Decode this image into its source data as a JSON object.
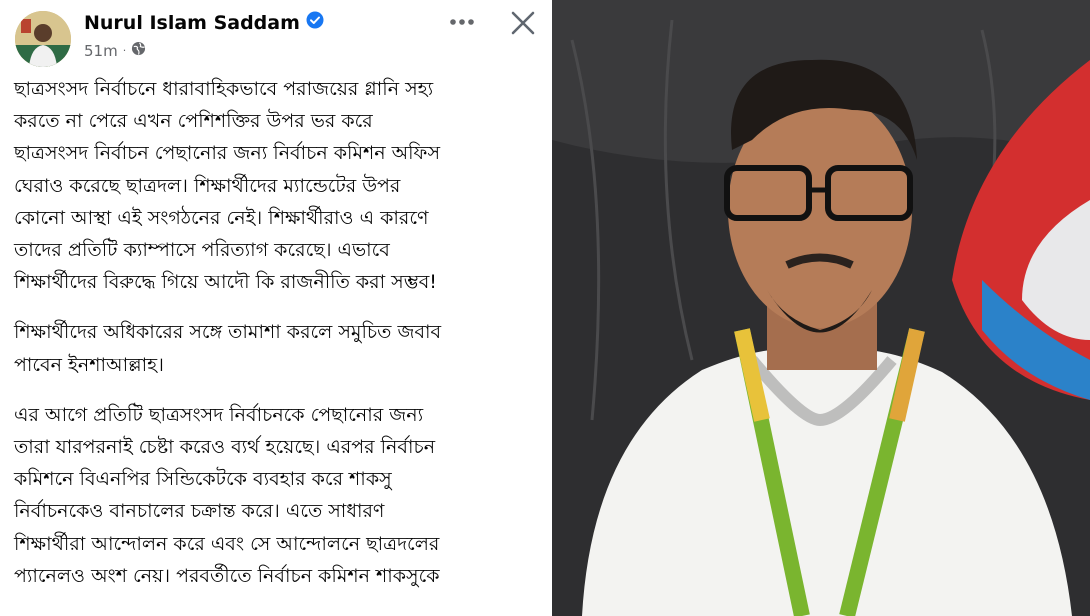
{
  "post": {
    "author": "Nurul Islam Saddam",
    "time": "51m",
    "paragraphs": [
      [
        "ছাত্রসংসদ নির্বাচনে ধারাবাহিকভাবে পরাজয়ের গ্লানি সহ্য",
        "করতে না পেরে এখন পেশিশক্তির উপর ভর করে",
        "ছাত্রসংসদ নির্বাচন পেছানোর জন্য নির্বাচন কমিশন অফিস",
        "ঘেরাও করেছে ছাত্রদল। শিক্ষার্থীদের ম্যান্ডেটের উপর",
        "কোনো আস্থা এই সংগঠনের নেই। শিক্ষার্থীরাও এ কারণে",
        "তাদের প্রতিটি ক্যাম্পাসে পরিত্যাগ করেছে। এভাবে",
        "শিক্ষার্থীদের বিরুদ্ধে গিয়ে আদৌ কি রাজনীতি করা সম্ভব!"
      ],
      [
        "শিক্ষার্থীদের অধিকারের সঙ্গে তামাশা করলে সমুচিত জবাব",
        "পাবেন ইনশাআল্লাহ।"
      ],
      [
        "এর আগে প্রতিটি ছাত্রসংসদ নির্বাচনকে পেছানোর জন্য",
        "তারা যারপরনাই চেষ্টা করেও ব্যর্থ হয়েছে। এরপর নির্বাচন",
        "কমিশনে বিএনপির সিন্ডিকেটকে ব্যবহার করে শাকসু",
        "নির্বাচনকেও বানচালের চক্রান্ত করে। এতে সাধারণ",
        "শিক্ষার্থীরা আন্দোলন করে এবং সে আন্দোলনে ছাত্রদলের",
        "প্যানেলও অংশ নেয়। পরবর্তীতে নির্বাচন কমিশন শাকসুকে"
      ]
    ]
  },
  "icons": {
    "verified": "verified-badge-icon",
    "audience": "globe-icon",
    "more": "more-options-icon",
    "close": "close-icon"
  },
  "colors": {
    "verified": "#1877f2",
    "meta": "#65676b",
    "text": "#050505"
  }
}
